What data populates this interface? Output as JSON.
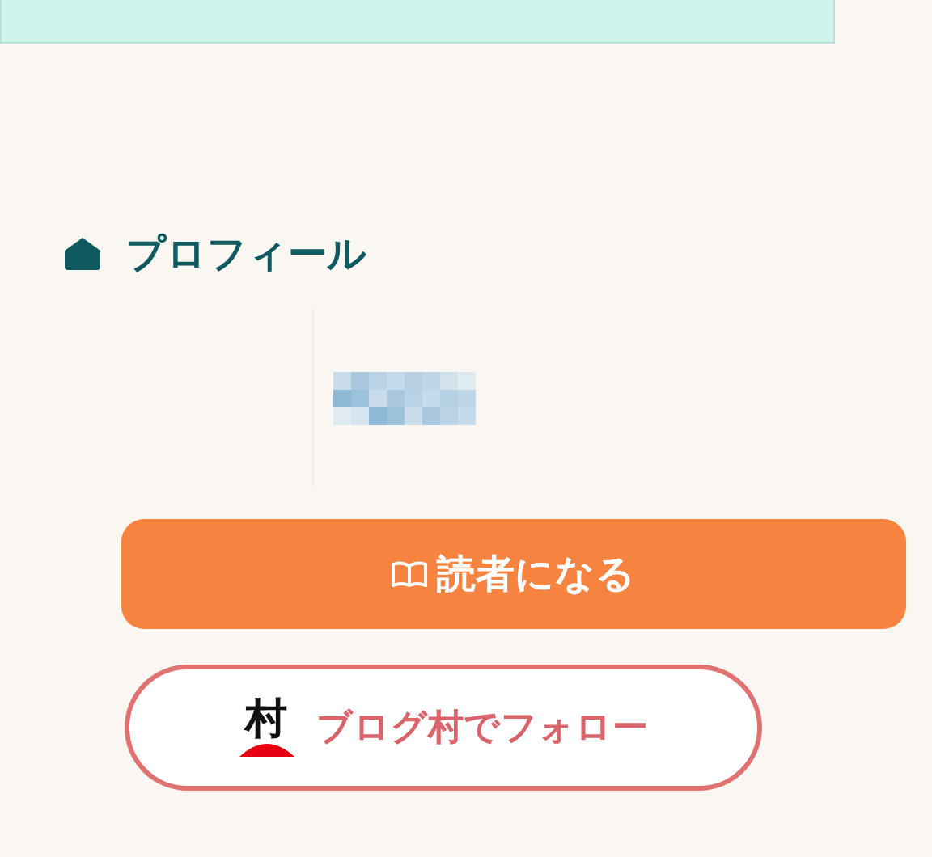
{
  "profile": {
    "title": "プロフィール"
  },
  "buttons": [
    {
      "kind": "reader",
      "label": "読者になる"
    },
    {
      "kind": "blogmura",
      "logo_text": "村",
      "label": "ブログ村でフォロー"
    }
  ]
}
